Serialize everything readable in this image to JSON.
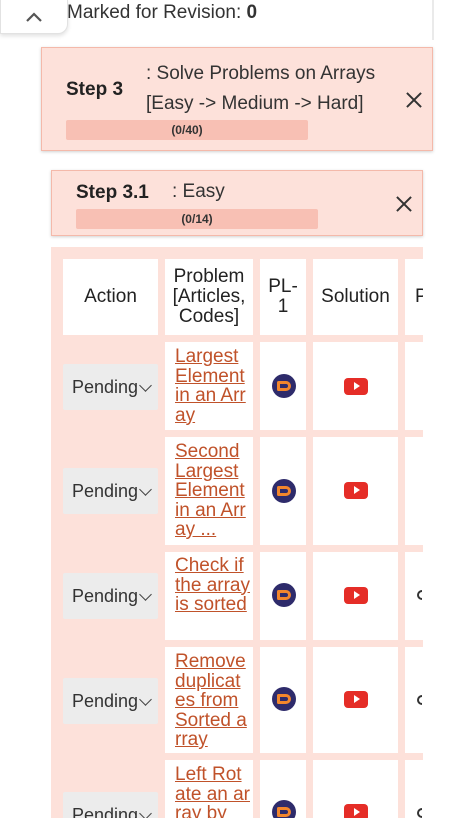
{
  "header": {
    "revision_label": "Marked for Revision:",
    "revision_count": "0"
  },
  "step3": {
    "title": "Step 3",
    "desc_line1": ": Solve Problems on Arrays",
    "desc_line2": "[Easy -> Medium -> Hard]",
    "progress_text": "(0/40)",
    "progress_value": 0
  },
  "step31": {
    "title": "Step 3.1",
    "desc": ": Easy",
    "progress_text": "(0/14)",
    "progress_value": 0
  },
  "table": {
    "columns": [
      "Action",
      "Problem [Articles, Codes]",
      "PL- 1",
      "Solution",
      "P"
    ],
    "rows": [
      {
        "action": "Pending",
        "problem": "Largest Element in an Array"
      },
      {
        "action": "Pending",
        "problem": "Second Largest Element in an Array ..."
      },
      {
        "action": "Pending",
        "problem": "Check if the array is sorted"
      },
      {
        "action": "Pending",
        "problem": "Remove duplicates from Sorted array"
      },
      {
        "action": "Pending",
        "problem": "Left Rotate an array by"
      }
    ]
  },
  "icons": {
    "collapse": "chevron-up-icon",
    "close": "close-icon",
    "practice": "codingninjas-icon",
    "video": "youtube-icon"
  },
  "colors": {
    "panel_bg": "#fde1da",
    "progress_bg": "#f8c0b4",
    "link": "#c0522a",
    "youtube": "#e52d27"
  }
}
